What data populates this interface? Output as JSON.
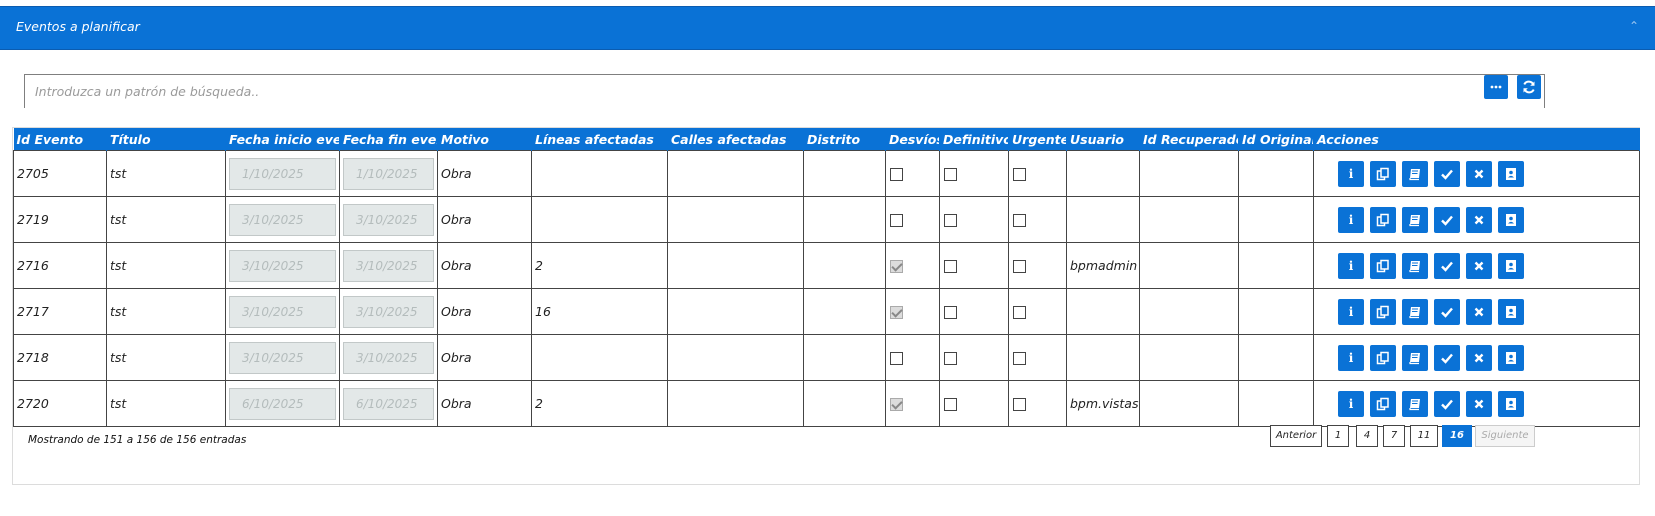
{
  "header": {
    "title": "Eventos a planificar",
    "collapse_icon": "chevron-up-icon"
  },
  "search": {
    "placeholder": "Introduzca un patrón de búsqueda.."
  },
  "toolbar": {
    "more_icon": "ellipsis-icon",
    "refresh_icon": "refresh-icon"
  },
  "table": {
    "columns": [
      "Id Evento",
      "Título",
      "Fecha inicio evento",
      "Fecha fin evento",
      "Motivo",
      "Líneas afectadas",
      "Calles afectadas",
      "Distrito",
      "Desvíos",
      "Definitivo",
      "Urgente",
      "Usuario",
      "Id Recuperado",
      "Id Original",
      "Acciones"
    ],
    "rows": [
      {
        "id": "2705",
        "titulo": "tst",
        "inicio": "1/10/2025",
        "fin": "1/10/2025",
        "motivo": "Obra",
        "lineas": "",
        "calles": "",
        "distrito": "",
        "desvios": false,
        "definitivo": false,
        "urgente": false,
        "usuario": "",
        "id_recuperado": "",
        "id_original": ""
      },
      {
        "id": "2719",
        "titulo": "tst",
        "inicio": "3/10/2025",
        "fin": "3/10/2025",
        "motivo": "Obra",
        "lineas": "",
        "calles": "",
        "distrito": "",
        "desvios": false,
        "definitivo": false,
        "urgente": false,
        "usuario": "",
        "id_recuperado": "",
        "id_original": ""
      },
      {
        "id": "2716",
        "titulo": "tst",
        "inicio": "3/10/2025",
        "fin": "3/10/2025",
        "motivo": "Obra",
        "lineas": "2",
        "calles": "",
        "distrito": "",
        "desvios": true,
        "definitivo": false,
        "urgente": false,
        "usuario": "bpmadmin",
        "id_recuperado": "",
        "id_original": ""
      },
      {
        "id": "2717",
        "titulo": "tst",
        "inicio": "3/10/2025",
        "fin": "3/10/2025",
        "motivo": "Obra",
        "lineas": "16",
        "calles": "",
        "distrito": "",
        "desvios": true,
        "definitivo": false,
        "urgente": false,
        "usuario": "",
        "id_recuperado": "",
        "id_original": ""
      },
      {
        "id": "2718",
        "titulo": "tst",
        "inicio": "3/10/2025",
        "fin": "3/10/2025",
        "motivo": "Obra",
        "lineas": "",
        "calles": "",
        "distrito": "",
        "desvios": false,
        "definitivo": false,
        "urgente": false,
        "usuario": "",
        "id_recuperado": "",
        "id_original": ""
      },
      {
        "id": "2720",
        "titulo": "tst",
        "inicio": "6/10/2025",
        "fin": "6/10/2025",
        "motivo": "Obra",
        "lineas": "2",
        "calles": "",
        "distrito": "",
        "desvios": true,
        "definitivo": false,
        "urgente": false,
        "usuario": "bpm.vistas",
        "id_recuperado": "",
        "id_original": ""
      }
    ],
    "action_icons": [
      "info-icon",
      "copy-icon",
      "book-icon",
      "check-icon",
      "close-icon",
      "contact-icon"
    ]
  },
  "footer": {
    "info": "Mostrando de 151 a 156 de 156 entradas",
    "pagination": {
      "prev": "Anterior",
      "pages": [
        "1",
        "4",
        "7",
        "11",
        "16"
      ],
      "current": "16",
      "next": "Siguiente"
    }
  },
  "colors": {
    "accent": "#0a72d6"
  }
}
